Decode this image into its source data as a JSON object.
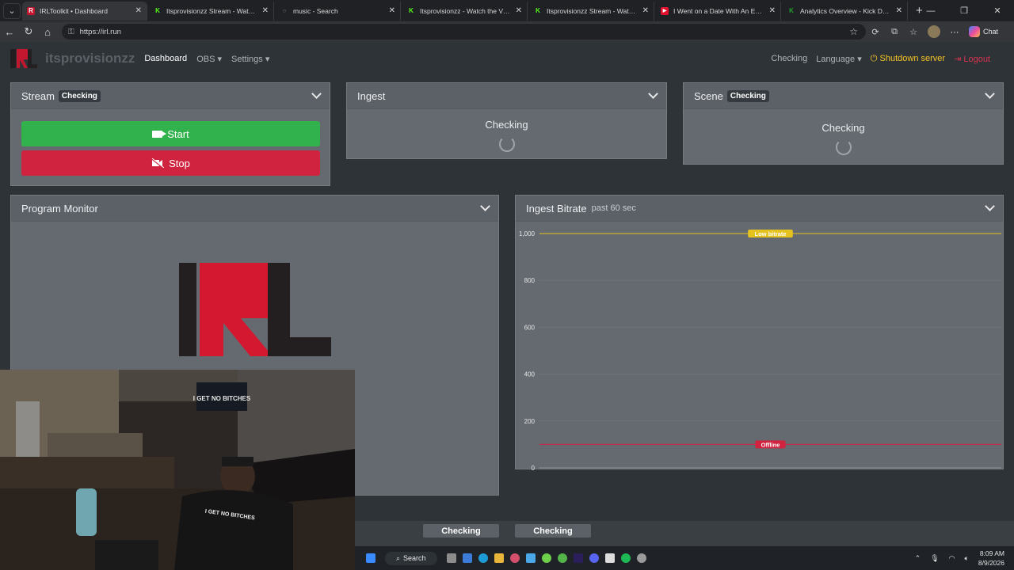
{
  "browser": {
    "tabs": [
      {
        "title": "IRLToolkit • Dashboard",
        "icon": "irl-favicon",
        "active": true
      },
      {
        "title": "Itsprovisionzz Stream - Watch Live",
        "icon": "kick-favicon"
      },
      {
        "title": "music - Search",
        "icon": "search-favicon"
      },
      {
        "title": "Itsprovisionzz - Watch the VOD on",
        "icon": "kick-favicon"
      },
      {
        "title": "Itsprovisionzz Stream - Watch Live",
        "icon": "kick-favicon"
      },
      {
        "title": "I Went on a Date With An Emo Gi",
        "icon": "youtube-favicon"
      },
      {
        "title": "Analytics Overview - Kick Dashbo",
        "icon": "kick-favicon"
      }
    ],
    "url": "https://irl.run",
    "chat_label": "Chat"
  },
  "nav": {
    "brand": "itsprovisionzz",
    "dashboard": "Dashboard",
    "obs": "OBS",
    "settings": "Settings",
    "status": "Checking",
    "language": "Language",
    "shutdown": "Shutdown server",
    "logout": "Logout"
  },
  "stream_card": {
    "title": "Stream",
    "badge": "Checking",
    "start_label": "Start",
    "stop_label": "Stop"
  },
  "ingest_card": {
    "title": "Ingest",
    "status": "Checking"
  },
  "scene_card": {
    "title": "Scene",
    "badge": "Checking",
    "status": "Checking"
  },
  "program_card": {
    "title": "Program Monitor"
  },
  "bitrate_card": {
    "title": "Ingest Bitrate",
    "subtitle": "past 60 sec"
  },
  "chart_data": {
    "type": "line",
    "y_ticks": [
      0,
      200,
      400,
      600,
      800,
      1000
    ],
    "y_tick_labels": [
      "0",
      "200",
      "400",
      "600",
      "800",
      "1,000"
    ],
    "ylim": [
      0,
      1000
    ],
    "grid": true,
    "thresholds": [
      {
        "value": 1000,
        "label": "Low bitrate",
        "color": "#e6c21f"
      },
      {
        "value": 100,
        "label": "Offline",
        "color": "#d0233f"
      }
    ],
    "series": []
  },
  "bottom": {
    "pill1": "Checking",
    "pill2": "Checking"
  },
  "webcam": {
    "poster_text": "I GET NO BITCHES",
    "shirt_text": "I GET NO BITCHES"
  },
  "taskbar": {
    "search_label": "Search",
    "time": "8:09 AM",
    "date": "8/9/2026"
  },
  "colors": {
    "accent_green": "#31b24c",
    "accent_red": "#d0233f",
    "shutdown_yellow": "#f7c325",
    "card_bg": "#646a70",
    "page_bg": "#2e3338"
  }
}
